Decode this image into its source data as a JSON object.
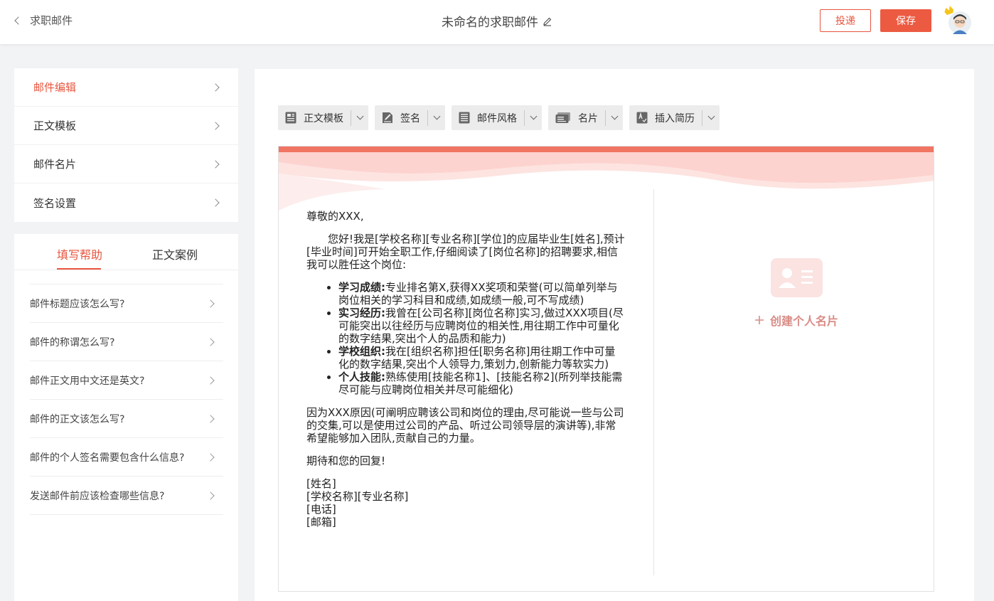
{
  "header": {
    "back_label": "求职邮件",
    "title": "未命名的求职邮件",
    "deliver_label": "投递",
    "save_label": "保存"
  },
  "leftnav": {
    "items": [
      {
        "label": "邮件编辑"
      },
      {
        "label": "正文模板"
      },
      {
        "label": "邮件名片"
      },
      {
        "label": "签名设置"
      }
    ]
  },
  "help": {
    "tabs": [
      {
        "label": "填写帮助"
      },
      {
        "label": "正文案例"
      }
    ],
    "questions": [
      "邮件标题应该怎么写?",
      "邮件的称谓怎么写?",
      "邮件正文用中文还是英文?",
      "邮件的正文该怎么写?",
      "邮件的个人签名需要包含什么信息?",
      "发送邮件前应该检查哪些信息?"
    ]
  },
  "toolbar": {
    "tools": [
      {
        "label": "正文模板",
        "icon": "template-icon"
      },
      {
        "label": "签名",
        "icon": "signature-icon"
      },
      {
        "label": "邮件风格",
        "icon": "style-icon"
      },
      {
        "label": "名片",
        "icon": "card-icon"
      },
      {
        "label": "插入简历",
        "icon": "resume-icon"
      }
    ]
  },
  "letter": {
    "greeting": "尊敬的XXX,",
    "intro": "您好!我是[学校名称][专业名称][学位]的应届毕业生[姓名],预计[毕业时间]可开始全职工作,仔细阅读了[岗位名称]的招聘要求,相信我可以胜任这个岗位:",
    "bullets": [
      {
        "head": "学习成绩:",
        "text": "专业排名第X,获得XX奖项和荣誉(可以简单列举与岗位相关的学习科目和成绩,如成绩一般,可不写成绩)"
      },
      {
        "head": "实习经历:",
        "text": "我曾在[公司名称][岗位名称]实习,做过XXX项目(尽可能突出以往经历与应聘岗位的相关性,用往期工作中可量化的数字结果,突出个人的品质和能力)"
      },
      {
        "head": "学校组织:",
        "text": "我在[组织名称]担任[职务名称]用往期工作中可量化的数字结果,突出个人领导力,策划力,创新能力等软实力)"
      },
      {
        "head": "个人技能:",
        "text": "熟练使用[技能名称1]、[技能名称2](所列举技能需尽可能与应聘岗位相关并尽可能细化)"
      }
    ],
    "reason": "因为XXX原因(可阐明应聘该公司和岗位的理由,尽可能说一些与公司的交集,可以是使用过公司的产品、听过公司领导层的演讲等),非常希望能够加入团队,贡献自己的力量。",
    "closing": "期待和您的回复!",
    "signature": [
      "[姓名]",
      "[学校名称][专业名称]",
      "[电话]",
      "[邮箱]"
    ]
  },
  "card": {
    "create_label": "创建个人名片"
  },
  "colors": {
    "accent": "#e8553e",
    "banner": "#fbd6d2"
  }
}
